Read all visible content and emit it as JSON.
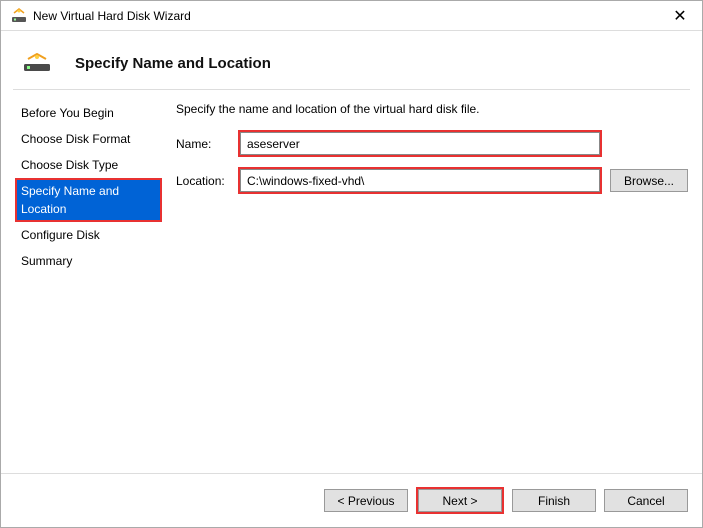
{
  "window": {
    "title": "New Virtual Hard Disk Wizard"
  },
  "header": {
    "title": "Specify Name and Location"
  },
  "steps": {
    "s0": "Before You Begin",
    "s1": "Choose Disk Format",
    "s2": "Choose Disk Type",
    "s3": "Specify Name and Location",
    "s4": "Configure Disk",
    "s5": "Summary"
  },
  "content": {
    "instruction": "Specify the name and location of the virtual hard disk file.",
    "name_label": "Name:",
    "name_value": "aseserver",
    "location_label": "Location:",
    "location_value": "C:\\windows-fixed-vhd\\",
    "browse_label": "Browse..."
  },
  "buttons": {
    "previous": "< Previous",
    "next": "Next >",
    "finish": "Finish",
    "cancel": "Cancel"
  }
}
